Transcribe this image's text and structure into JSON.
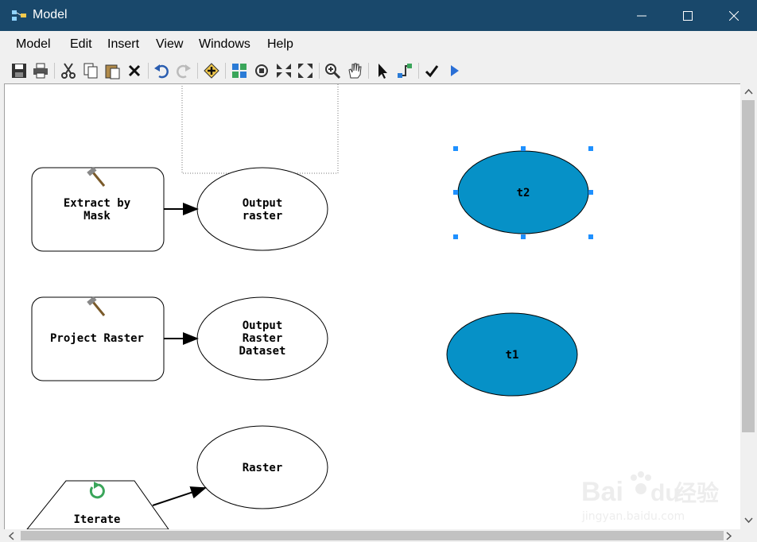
{
  "window": {
    "title": "Model"
  },
  "menu": [
    "Model",
    "Edit",
    "Insert",
    "View",
    "Windows",
    "Help"
  ],
  "toolbar": [
    "save-icon",
    "print-icon",
    "cut-icon",
    "copy-icon",
    "paste-icon",
    "delete-icon",
    "undo-icon",
    "redo-icon",
    "add-data-icon",
    "auto-layout-icon",
    "full-extent-icon",
    "zoom-in-fixed-icon",
    "zoom-out-fixed-icon",
    "zoom-in-icon",
    "pan-icon",
    "select-icon",
    "connect-icon",
    "validate-icon",
    "run-icon"
  ],
  "model": {
    "tool_extract": {
      "label_line1": "Extract by",
      "label_line2": "Mask"
    },
    "output_raster": {
      "label_line1": "Output",
      "label_line2": "raster"
    },
    "tool_project": {
      "label": "Project Raster"
    },
    "output_dataset": {
      "label_line1": "Output",
      "label_line2": "Raster",
      "label_line3": "Dataset"
    },
    "iterator": {
      "label": "Iterate"
    },
    "raster": {
      "label": "Raster"
    },
    "var_t2": {
      "label": "t2"
    },
    "var_t1": {
      "label": "t1"
    }
  },
  "watermark": {
    "brand_a": "Bai",
    "brand_b": "du",
    "brand_c": "经验",
    "url": "jingyan.baidu.com"
  },
  "colors": {
    "titlebar": "#19486b",
    "variable_fill": "#0691c7",
    "selection_handle": "#1e90ff"
  }
}
